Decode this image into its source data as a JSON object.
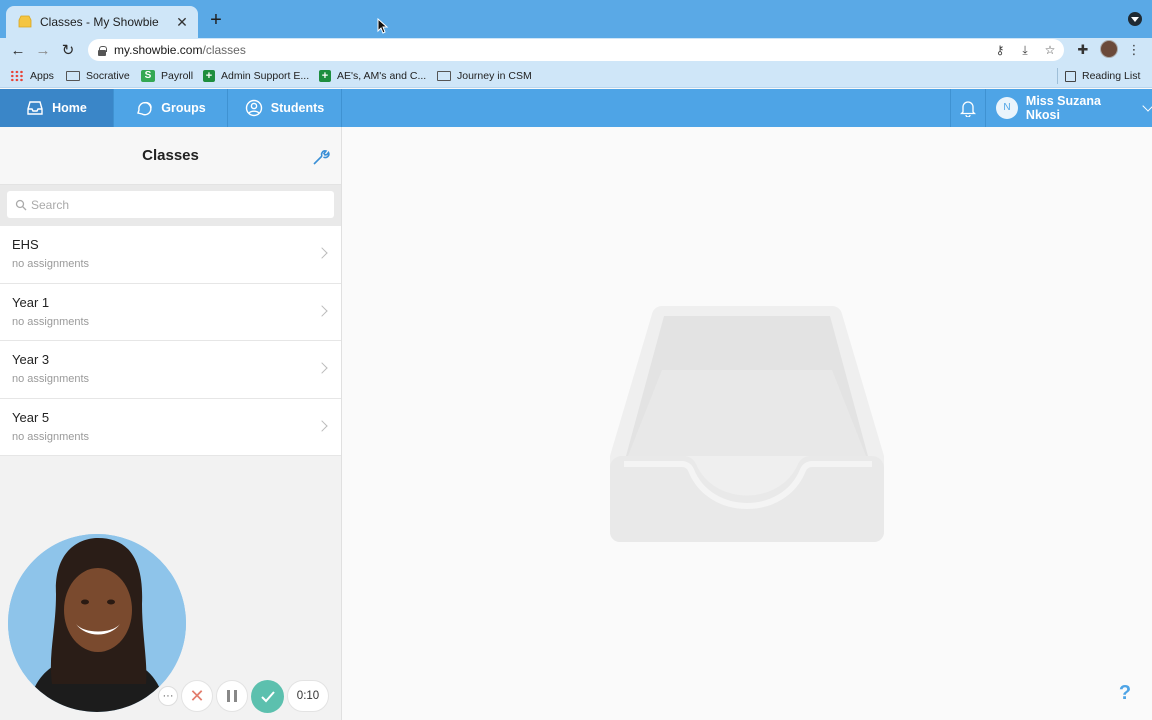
{
  "browser": {
    "tab_title": "Classes - My Showbie",
    "url_host": "my.showbie.com",
    "url_path": "/classes",
    "bookmarks": [
      {
        "label": "Apps",
        "icon": "apps-grid-icon"
      },
      {
        "label": "Socrative",
        "icon": "folder-icon"
      },
      {
        "label": "Payroll",
        "icon": "sheets-s-icon"
      },
      {
        "label": "Admin Support E...",
        "icon": "green-plus-icon"
      },
      {
        "label": "AE's, AM's and C...",
        "icon": "green-plus-icon"
      },
      {
        "label": "Journey in CSM",
        "icon": "folder-icon"
      }
    ],
    "reading_list": "Reading List"
  },
  "app": {
    "nav": [
      {
        "label": "Home",
        "icon": "inbox-icon",
        "active": true
      },
      {
        "label": "Groups",
        "icon": "chat-bubbles-icon",
        "active": false
      },
      {
        "label": "Students",
        "icon": "person-icon",
        "active": false
      }
    ],
    "user": {
      "initial": "N",
      "name": "Miss Suzana Nkosi"
    }
  },
  "sidebar": {
    "title": "Classes",
    "search_placeholder": "Search",
    "classes": [
      {
        "name": "EHS",
        "status": "no assignments"
      },
      {
        "name": "Year 1",
        "status": "no assignments"
      },
      {
        "name": "Year 3",
        "status": "no assignments"
      },
      {
        "name": "Year 5",
        "status": "no assignments"
      }
    ]
  },
  "main": {
    "help_label": "?"
  },
  "recorder": {
    "more_label": "···",
    "timer": "0:10"
  },
  "colors": {
    "brand_blue": "#4ea4e6",
    "active_nav": "#3a86c8",
    "done_green": "#5cc0ae",
    "cancel_red": "#e27c6c"
  }
}
